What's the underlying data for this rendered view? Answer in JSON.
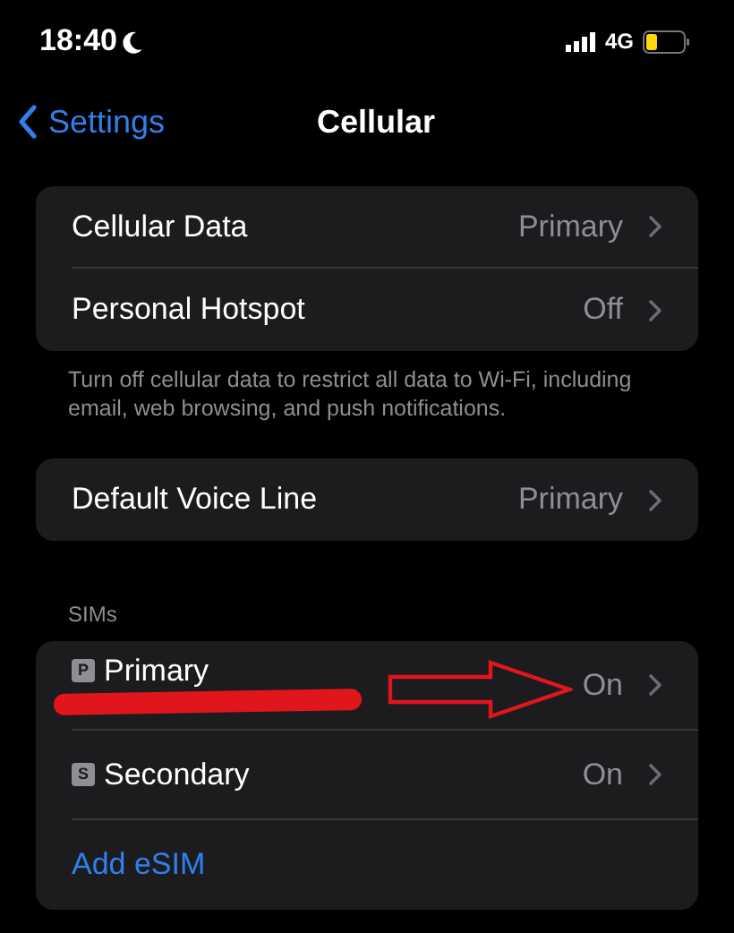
{
  "status_bar": {
    "time": "18:40",
    "network": "4G"
  },
  "nav": {
    "back": "Settings",
    "title": "Cellular"
  },
  "groups": [
    {
      "rows": [
        {
          "label": "Cellular Data",
          "value": "Primary"
        },
        {
          "label": "Personal Hotspot",
          "value": "Off"
        }
      ],
      "footer": "Turn off cellular data to restrict all data to Wi-Fi, including email, web browsing, and push notifications."
    },
    {
      "rows": [
        {
          "label": "Default Voice Line",
          "value": "Primary"
        }
      ]
    },
    {
      "header": "SIMs",
      "rows": [
        {
          "kind": "sim",
          "badge": "P",
          "label": "Primary",
          "value": "On",
          "redacted": true,
          "arrow": true
        },
        {
          "kind": "sim",
          "badge": "S",
          "label": "Secondary",
          "value": "On",
          "redacted": false,
          "arrow": false
        },
        {
          "kind": "link",
          "label": "Add eSIM"
        }
      ]
    }
  ]
}
